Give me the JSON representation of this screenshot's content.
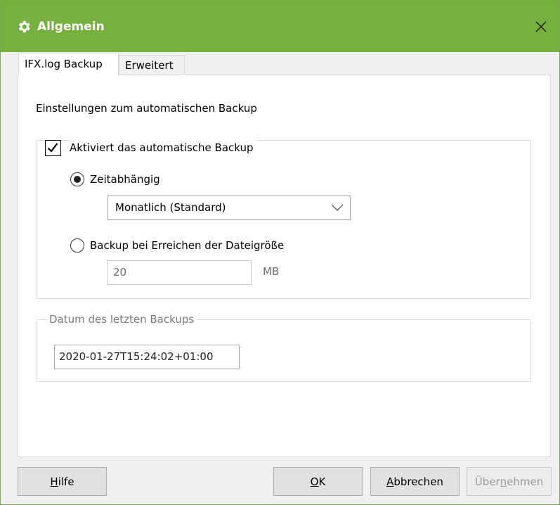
{
  "window": {
    "title": "Allgemein",
    "title_icon": "gear-icon",
    "close_icon": "close-icon",
    "accent_color": "#76b13f"
  },
  "tabs": [
    {
      "label": "IFX.log Backup",
      "active": true
    },
    {
      "label": "Erweitert",
      "active": false
    }
  ],
  "settings": {
    "description": "Einstellungen zum automatischen Backup",
    "auto_backup": {
      "label": "Aktiviert das automatische Backup",
      "checked": true
    },
    "time_based": {
      "label": "Zeitabhängig",
      "selected": true,
      "interval_value": "Monatlich (Standard)"
    },
    "size_based": {
      "label": "Backup bei Erreichen der Dateigröße",
      "selected": false,
      "size_value": "20",
      "unit": "MB"
    },
    "last_backup": {
      "legend": "Datum des letzten Backups",
      "value": "2020-01-27T15:24:02+01:00"
    }
  },
  "buttons": {
    "help": {
      "label": "Hilfe",
      "mnemonic": "H",
      "rest": "ilfe"
    },
    "ok": {
      "label": "OK",
      "mnemonic": "O",
      "rest": "K"
    },
    "cancel": {
      "label": "Abbrechen",
      "mnemonic": "A",
      "rest": "bbrechen"
    },
    "apply": {
      "label": "Übernehmen",
      "pre": "Über",
      "mnemonic": "n",
      "rest": "ehmen",
      "enabled": false
    }
  }
}
